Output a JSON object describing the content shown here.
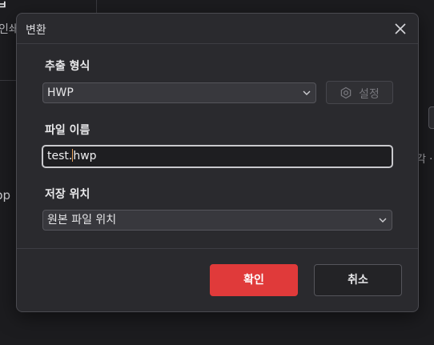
{
  "background": {
    "heading_fragment": "ㅂ",
    "subtext_fragment": "인쇄",
    "left_fragment": "pp",
    "right_fragment": "각 ·"
  },
  "dialog": {
    "title": "변환",
    "format": {
      "label": "추출 형식",
      "selected": "HWP",
      "settings_label": "설정"
    },
    "filename": {
      "label": "파일 이름",
      "value_before_caret": "test.",
      "value_after_caret": "hwp"
    },
    "location": {
      "label": "저장 위치",
      "selected": "원본 파일 위치"
    },
    "buttons": {
      "ok": "확인",
      "cancel": "취소"
    }
  },
  "colors": {
    "accent": "#e03a3a",
    "dialog_bg": "#2a2a2e",
    "caret": "#e8a25c"
  },
  "icons": {
    "close": "close-icon",
    "gear": "gear-icon",
    "chevron": "chevron-down-icon"
  }
}
